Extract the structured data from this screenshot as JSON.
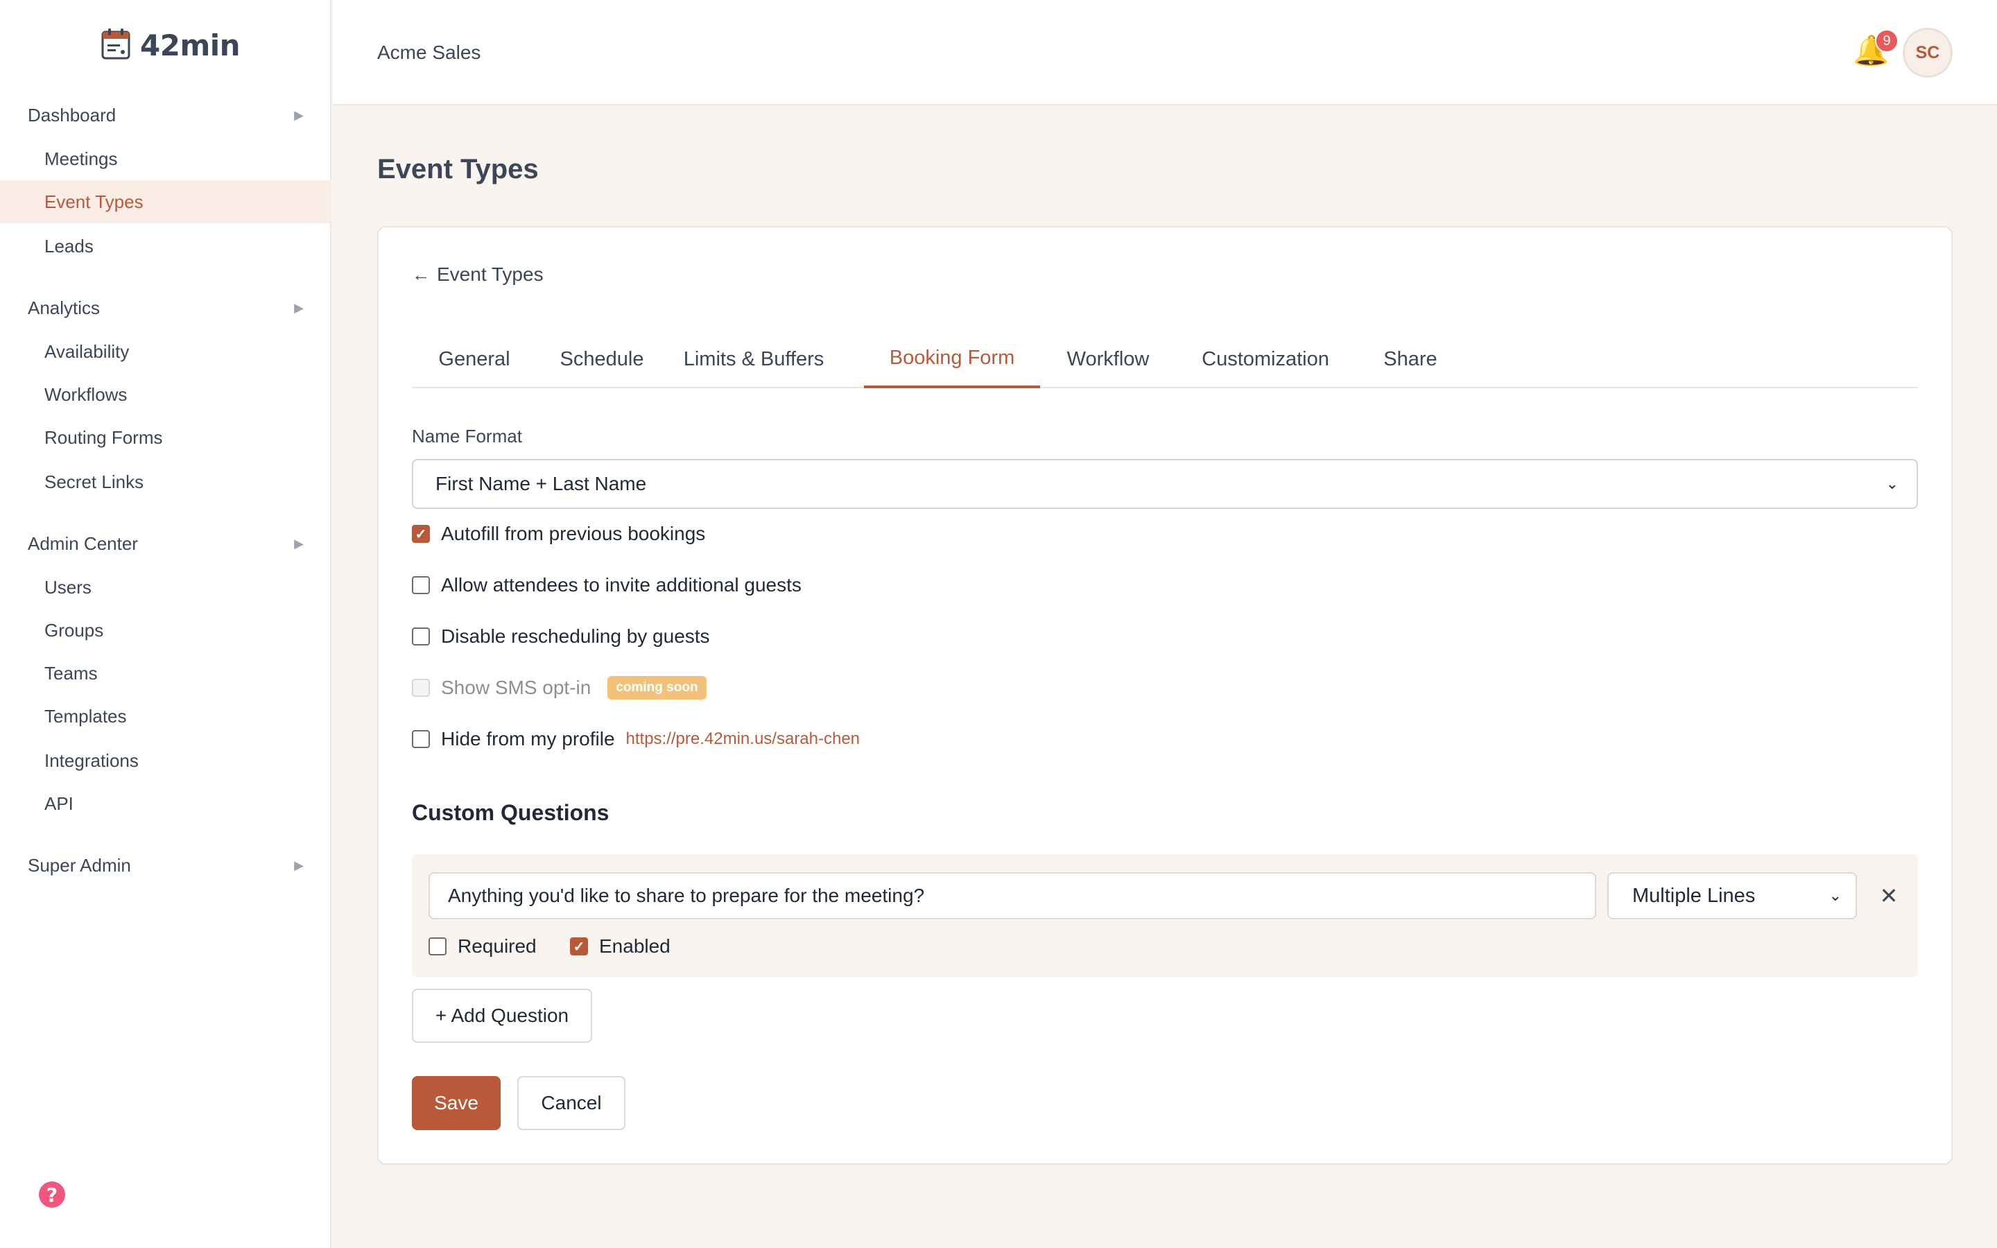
{
  "app": {
    "logo_text": "42min",
    "logo_icon": "calendar-icon",
    "accent_color": "#b85a3a"
  },
  "sidebar": {
    "groups": [
      {
        "label": "Dashboard",
        "items": [
          "Meetings",
          "Event Types",
          "Leads"
        ]
      },
      {
        "label": "Analytics",
        "items": [
          "Availability",
          "Workflows",
          "Routing Forms",
          "Secret Links"
        ]
      },
      {
        "label": "Admin Center",
        "items": [
          "Users",
          "Groups",
          "Teams",
          "Templates",
          "Integrations",
          "API"
        ]
      },
      {
        "label": "Super Admin",
        "items": []
      }
    ],
    "active_item": "Event Types",
    "arrow": "▶",
    "help_icon": "question-circle-icon"
  },
  "header": {
    "org_name": "Acme Sales",
    "notification_count": "9",
    "avatar_initials": "SC",
    "bell_icon": "bell-icon"
  },
  "page": {
    "title": "Event Types",
    "back_label": "Event Types",
    "back_arrow": "←"
  },
  "tabs": {
    "items": [
      "General",
      "Schedule",
      "Limits & Buffers",
      "Booking Form",
      "Workflow",
      "Customization",
      "Share"
    ],
    "active": "Booking Form"
  },
  "booking_form": {
    "name_format_label": "Name Format",
    "name_format_value": "First Name + Last Name",
    "options": [
      {
        "label": "Autofill from previous bookings",
        "checked": true,
        "disabled": false
      },
      {
        "label": "Allow attendees to invite additional guests",
        "checked": false,
        "disabled": false
      },
      {
        "label": "Disable rescheduling by guests",
        "checked": false,
        "disabled": false
      },
      {
        "label": "Show SMS opt-in",
        "checked": false,
        "disabled": true,
        "badge": "coming soon"
      },
      {
        "label": "Hide from my profile",
        "checked": false,
        "disabled": false,
        "link": "https://pre.42min.us/sarah-chen"
      }
    ]
  },
  "custom_questions": {
    "title": "Custom Questions",
    "questions": [
      {
        "text": "Anything you'd like to share to prepare for the meeting?",
        "type": "Multiple Lines",
        "required_label": "Required",
        "required": false,
        "enabled_label": "Enabled",
        "enabled": true
      }
    ],
    "add_label": "+ Add Question",
    "remove_glyph": "✕"
  },
  "actions": {
    "save_label": "Save",
    "cancel_label": "Cancel"
  }
}
